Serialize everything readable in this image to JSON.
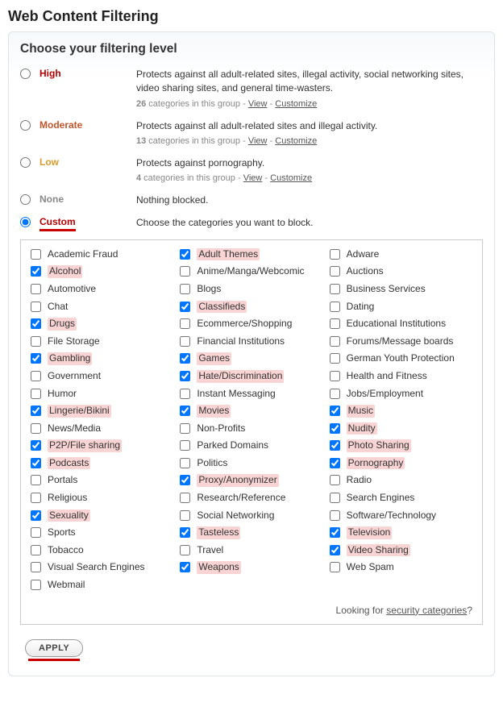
{
  "page_title": "Web Content Filtering",
  "panel_heading": "Choose your filtering level",
  "levels": [
    {
      "id": "high",
      "name": "High",
      "class": "lvl-high",
      "selected": false,
      "desc": "Protects against all adult-related sites, illegal activity, social networking sites, video sharing sites, and general time-wasters.",
      "count": "26",
      "count_suffix": " categories in this group - ",
      "view": "View",
      "dash": " - ",
      "customize": "Customize"
    },
    {
      "id": "moderate",
      "name": "Moderate",
      "class": "lvl-moderate",
      "selected": false,
      "desc": "Protects against all adult-related sites and illegal activity.",
      "count": "13",
      "count_suffix": " categories in this group - ",
      "view": "View",
      "dash": " - ",
      "customize": "Customize"
    },
    {
      "id": "low",
      "name": "Low",
      "class": "lvl-low",
      "selected": false,
      "desc": "Protects against pornography.",
      "count": "4",
      "count_suffix": " categories in this group - ",
      "view": "View",
      "dash": " - ",
      "customize": "Customize"
    },
    {
      "id": "none",
      "name": "None",
      "class": "lvl-none",
      "selected": false,
      "desc": "Nothing blocked."
    },
    {
      "id": "custom",
      "name": "Custom",
      "class": "lvl-custom",
      "selected": true,
      "desc": "Choose the categories you want to block."
    }
  ],
  "categories": [
    {
      "label": "Academic Fraud",
      "checked": false
    },
    {
      "label": "Adult Themes",
      "checked": true
    },
    {
      "label": "Adware",
      "checked": false
    },
    {
      "label": "Alcohol",
      "checked": true
    },
    {
      "label": "Anime/Manga/Webcomic",
      "checked": false
    },
    {
      "label": "Auctions",
      "checked": false
    },
    {
      "label": "Automotive",
      "checked": false
    },
    {
      "label": "Blogs",
      "checked": false
    },
    {
      "label": "Business Services",
      "checked": false
    },
    {
      "label": "Chat",
      "checked": false
    },
    {
      "label": "Classifieds",
      "checked": true
    },
    {
      "label": "Dating",
      "checked": false
    },
    {
      "label": "Drugs",
      "checked": true
    },
    {
      "label": "Ecommerce/Shopping",
      "checked": false
    },
    {
      "label": "Educational Institutions",
      "checked": false
    },
    {
      "label": "File Storage",
      "checked": false
    },
    {
      "label": "Financial Institutions",
      "checked": false
    },
    {
      "label": "Forums/Message boards",
      "checked": false
    },
    {
      "label": "Gambling",
      "checked": true
    },
    {
      "label": "Games",
      "checked": true
    },
    {
      "label": "German Youth Protection",
      "checked": false
    },
    {
      "label": "Government",
      "checked": false
    },
    {
      "label": "Hate/Discrimination",
      "checked": true
    },
    {
      "label": "Health and Fitness",
      "checked": false
    },
    {
      "label": "Humor",
      "checked": false
    },
    {
      "label": "Instant Messaging",
      "checked": false
    },
    {
      "label": "Jobs/Employment",
      "checked": false
    },
    {
      "label": "Lingerie/Bikini",
      "checked": true
    },
    {
      "label": "Movies",
      "checked": true
    },
    {
      "label": "Music",
      "checked": true
    },
    {
      "label": "News/Media",
      "checked": false
    },
    {
      "label": "Non-Profits",
      "checked": false
    },
    {
      "label": "Nudity",
      "checked": true
    },
    {
      "label": "P2P/File sharing",
      "checked": true
    },
    {
      "label": "Parked Domains",
      "checked": false
    },
    {
      "label": "Photo Sharing",
      "checked": true
    },
    {
      "label": "Podcasts",
      "checked": true
    },
    {
      "label": "Politics",
      "checked": false
    },
    {
      "label": "Pornography",
      "checked": true
    },
    {
      "label": "Portals",
      "checked": false
    },
    {
      "label": "Proxy/Anonymizer",
      "checked": true
    },
    {
      "label": "Radio",
      "checked": false
    },
    {
      "label": "Religious",
      "checked": false
    },
    {
      "label": "Research/Reference",
      "checked": false
    },
    {
      "label": "Search Engines",
      "checked": false
    },
    {
      "label": "Sexuality",
      "checked": true
    },
    {
      "label": "Social Networking",
      "checked": false
    },
    {
      "label": "Software/Technology",
      "checked": false
    },
    {
      "label": "Sports",
      "checked": false
    },
    {
      "label": "Tasteless",
      "checked": true
    },
    {
      "label": "Television",
      "checked": true
    },
    {
      "label": "Tobacco",
      "checked": false
    },
    {
      "label": "Travel",
      "checked": false
    },
    {
      "label": "Video Sharing",
      "checked": true
    },
    {
      "label": "Visual Search Engines",
      "checked": false
    },
    {
      "label": "Weapons",
      "checked": true
    },
    {
      "label": "Web Spam",
      "checked": false
    },
    {
      "label": "Webmail",
      "checked": false
    }
  ],
  "footer_prefix": "Looking for ",
  "footer_link": "security categories",
  "footer_suffix": "?",
  "apply_label": "APPLY"
}
